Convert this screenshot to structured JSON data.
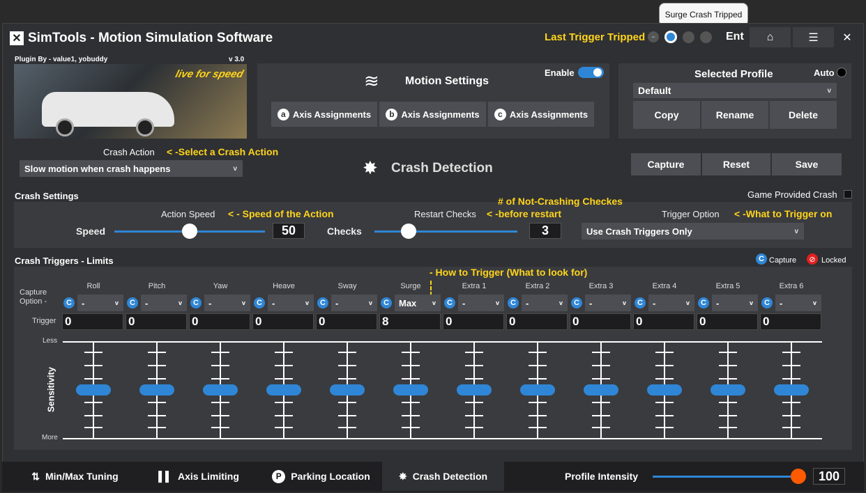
{
  "tooltip": "Surge Crash Tripped",
  "app": {
    "title": "SimTools - Motion Simulation Software"
  },
  "header": {
    "last_trigger_label": "Last Trigger Tripped",
    "arrow": "->",
    "ent_label": "Ent"
  },
  "plugin": {
    "by": "Plugin By - value1, yobuddy",
    "version": "v 3.0",
    "logo_text": "live for speed"
  },
  "motion": {
    "title": "Motion Settings",
    "enable_label": "Enable",
    "enabled": true,
    "axis_buttons": [
      {
        "letter": "a",
        "label": "Axis Assignments"
      },
      {
        "letter": "b",
        "label": "Axis Assignments"
      },
      {
        "letter": "c",
        "label": "Axis Assignments"
      }
    ]
  },
  "profile": {
    "title": "Selected Profile",
    "auto_label": "Auto",
    "selected": "Default",
    "copy": "Copy",
    "rename": "Rename",
    "delete": "Delete"
  },
  "crash_action": {
    "label": "Crash Action",
    "hint": "< -Select a Crash Action",
    "selected": "Slow motion when crash happens"
  },
  "crash_detection": {
    "title": "Crash Detection"
  },
  "actions": {
    "capture": "Capture",
    "reset": "Reset",
    "save": "Save"
  },
  "crash_settings": {
    "title": "Crash Settings",
    "game_provided": "Game Provided Crash",
    "action_speed_label": "Action Speed",
    "action_speed_hint": "< - Speed of the Action",
    "speed_label": "Speed",
    "speed_value": "50",
    "speed_fraction": 0.5,
    "restart_checks_label": "Restart Checks",
    "restart_hint": "< -before restart",
    "not_crashing_hint": "# of Not-Crashing Checkes",
    "checks_label": "Checks",
    "checks_value": "3",
    "checks_fraction": 0.24,
    "trigger_option_label": "Trigger Option",
    "trigger_hint": "< -What to Trigger on",
    "trigger_option_selected": "Use Crash Triggers Only"
  },
  "triggers": {
    "title": "Crash Triggers - Limits",
    "capture_legend": "Capture",
    "locked_legend": "Locked",
    "how_hint": "- How to Trigger (What to look for)",
    "capture_option_label": "Capture\nOption -",
    "trigger_label": "Trigger",
    "less_label": "Less",
    "more_label": "More",
    "sensitivity_label": "Sensitivity",
    "columns": [
      {
        "name": "Roll",
        "option": "-",
        "trigger": "0"
      },
      {
        "name": "Pitch",
        "option": "-",
        "trigger": "0"
      },
      {
        "name": "Yaw",
        "option": "-",
        "trigger": "0"
      },
      {
        "name": "Heave",
        "option": "-",
        "trigger": "0"
      },
      {
        "name": "Sway",
        "option": "-",
        "trigger": "0"
      },
      {
        "name": "Surge",
        "option": "Max",
        "trigger": "8"
      },
      {
        "name": "Extra 1",
        "option": "-",
        "trigger": "0"
      },
      {
        "name": "Extra 2",
        "option": "-",
        "trigger": "0"
      },
      {
        "name": "Extra 3",
        "option": "-",
        "trigger": "0"
      },
      {
        "name": "Extra 4",
        "option": "-",
        "trigger": "0"
      },
      {
        "name": "Extra 5",
        "option": "-",
        "trigger": "0"
      },
      {
        "name": "Extra 6",
        "option": "-",
        "trigger": "0"
      }
    ]
  },
  "bottom": {
    "tabs": [
      {
        "label": "Min/Max Tuning",
        "icon": "arrows-updown-icon"
      },
      {
        "label": "Axis Limiting",
        "icon": "bars-icon"
      },
      {
        "label": "Parking Location",
        "icon": "parking-icon"
      },
      {
        "label": "Crash Detection",
        "icon": "crash-burst-icon",
        "active": true
      }
    ],
    "intensity_label": "Profile Intensity",
    "intensity_value": "100"
  },
  "colors": {
    "accent": "#2f86d6",
    "hint": "#ffd51a",
    "slider_orange": "#ff5a00"
  }
}
